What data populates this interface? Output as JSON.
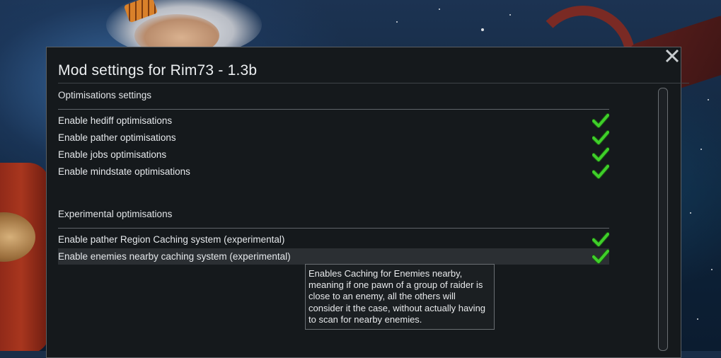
{
  "window": {
    "title": "Mod settings for Rim73 - 1.3b",
    "close_label": "×"
  },
  "sections": [
    {
      "heading": "Optimisations settings",
      "items": [
        {
          "label": "Enable hediff optimisations",
          "checked": true
        },
        {
          "label": "Enable pather optimisations",
          "checked": true
        },
        {
          "label": "Enable jobs optimisations",
          "checked": true
        },
        {
          "label": "Enable mindstate optimisations",
          "checked": true
        }
      ]
    },
    {
      "heading": "Experimental optimisations",
      "items": [
        {
          "label": "Enable pather Region Caching system (experimental)",
          "checked": true
        },
        {
          "label": "Enable enemies nearby caching system (experimental)",
          "checked": true
        }
      ]
    }
  ],
  "tooltip": {
    "text": "Enables Caching for Enemies nearby, meaning if one pawn of a group of raider is close to an enemy, all the others will consider it the case, without actually having to scan for nearby enemies."
  },
  "colors": {
    "check_green": "#3fcf2a",
    "dialog_bg": "#15191c",
    "hover_bg": "#2b2f33"
  },
  "icons": {
    "close": "close-icon",
    "check": "checkmark-icon"
  }
}
